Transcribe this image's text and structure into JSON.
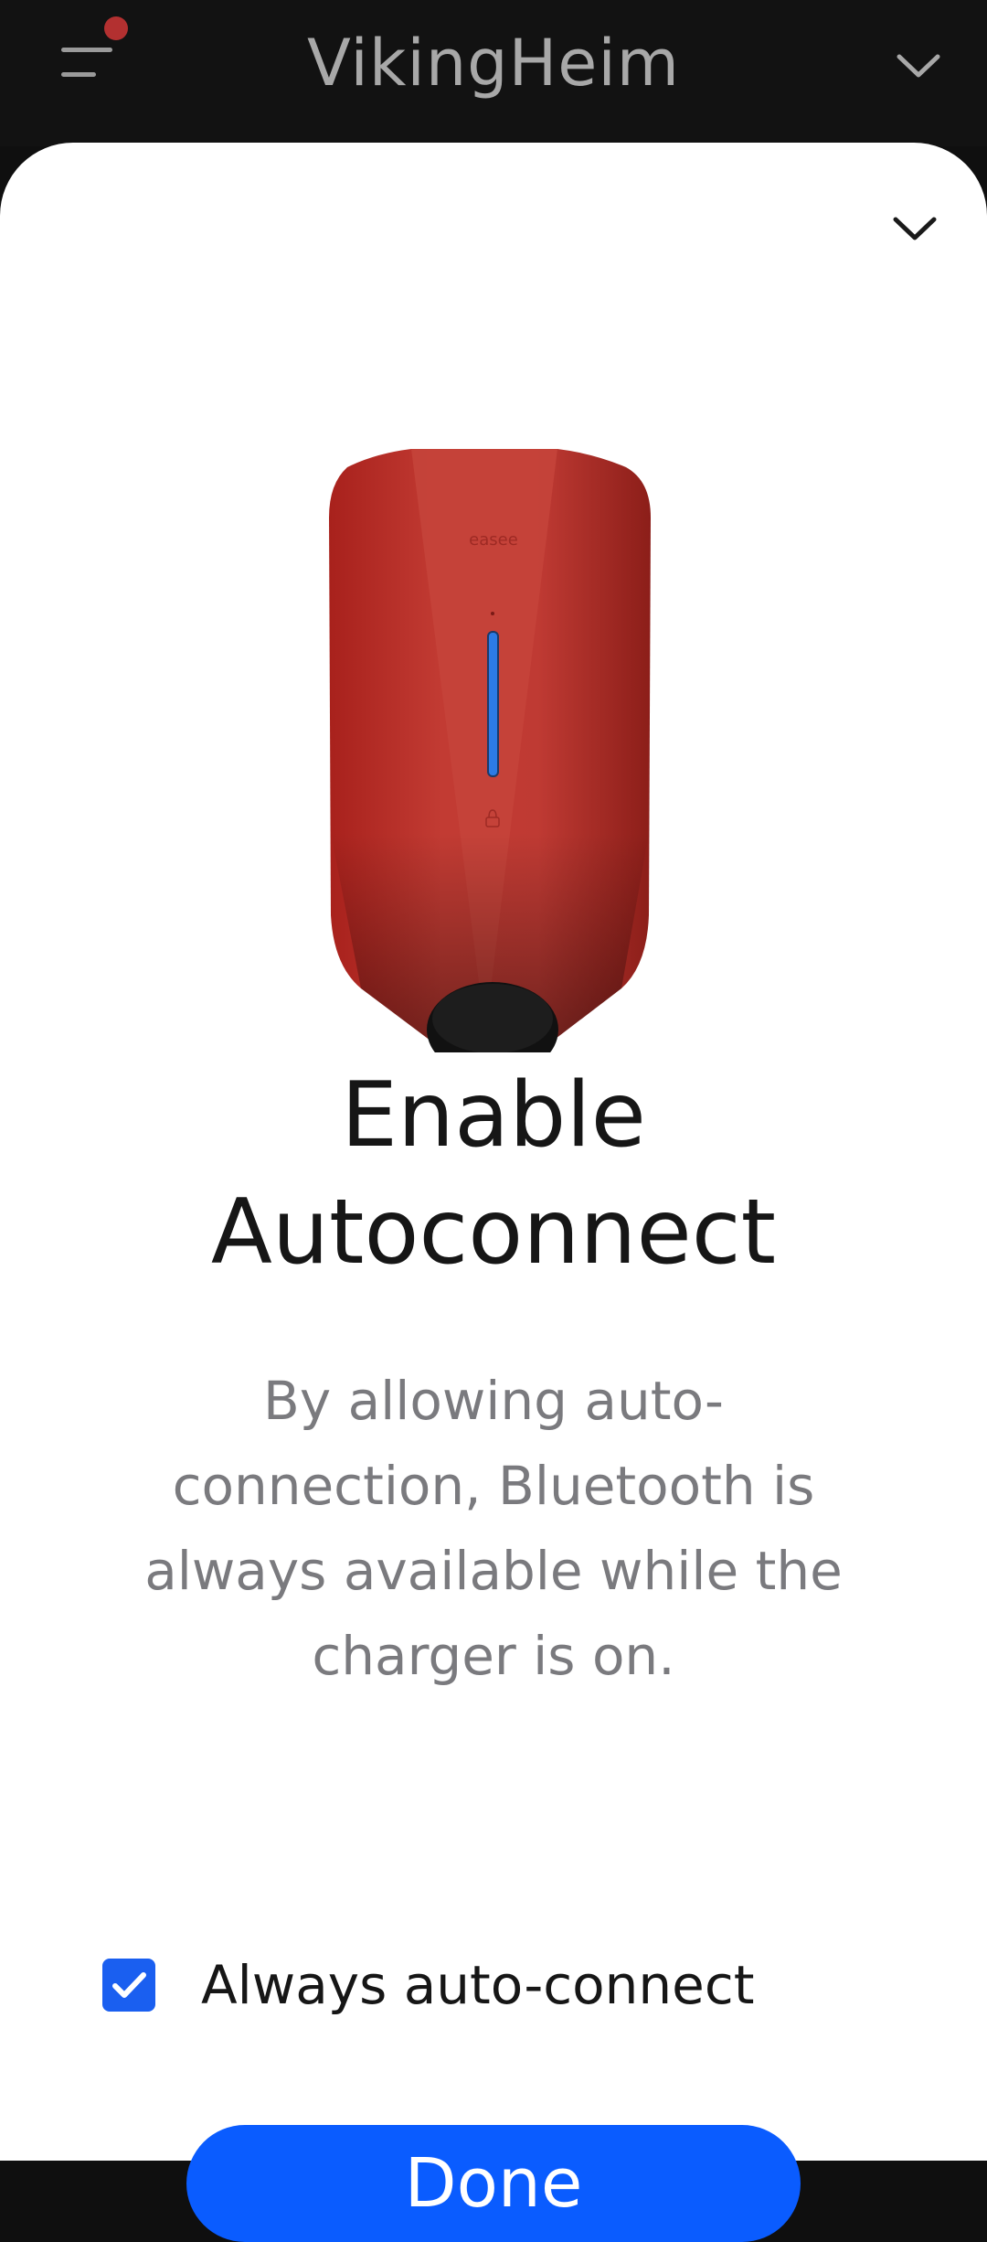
{
  "header": {
    "title": "VikingHeim",
    "menu_icon": "hamburger-menu-icon",
    "notification_dot_color": "#b33030",
    "site_dropdown_icon": "chevron-down-icon"
  },
  "sheet": {
    "collapse_icon": "chevron-down-icon",
    "image": "red-ev-charger",
    "brand_mark": "easee",
    "title_line1": "Enable",
    "title_line2": "Autoconnect",
    "description_line1": "By allowing auto-",
    "description_line2": "connection, Bluetooth is",
    "description_line3": "always available while the",
    "description_line4": "charger is on.",
    "checkbox": {
      "label": "Always auto-connect",
      "checked": true
    },
    "done_label": "Done"
  },
  "colors": {
    "accent": "#0a5cff",
    "charger_red": "#b8302a",
    "led_blue": "#2c7be5"
  }
}
